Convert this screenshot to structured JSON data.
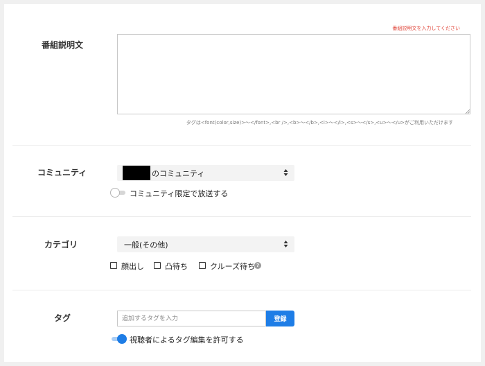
{
  "description": {
    "label": "番組説明文",
    "error": "番組説明文を入力してください",
    "value": "",
    "hint": "タグは<font(color,size)>～</font>,<br />,<b>～</b>,<i>～</i>,<s>～</s>,<u>～</u>がご利用いただけます"
  },
  "community": {
    "label": "コミュニティ",
    "selected": "のコミュニティ",
    "toggle_label": "コミュニティ限定で放送する",
    "toggle_on": false
  },
  "category": {
    "label": "カテゴリ",
    "selected": "一般(その他)",
    "options": [
      {
        "label": "顔出し",
        "checked": false
      },
      {
        "label": "凸待ち",
        "checked": false
      },
      {
        "label": "クルーズ待ち",
        "checked": false
      }
    ],
    "help": "?"
  },
  "tag": {
    "label": "タグ",
    "placeholder": "追加するタグを入力",
    "register_label": "登録",
    "toggle_label": "視聴者によるタグ編集を許可する",
    "toggle_on": true
  },
  "colors": {
    "accent": "#1e7de6",
    "error": "#e0463a",
    "background": "#f0f0f0"
  }
}
